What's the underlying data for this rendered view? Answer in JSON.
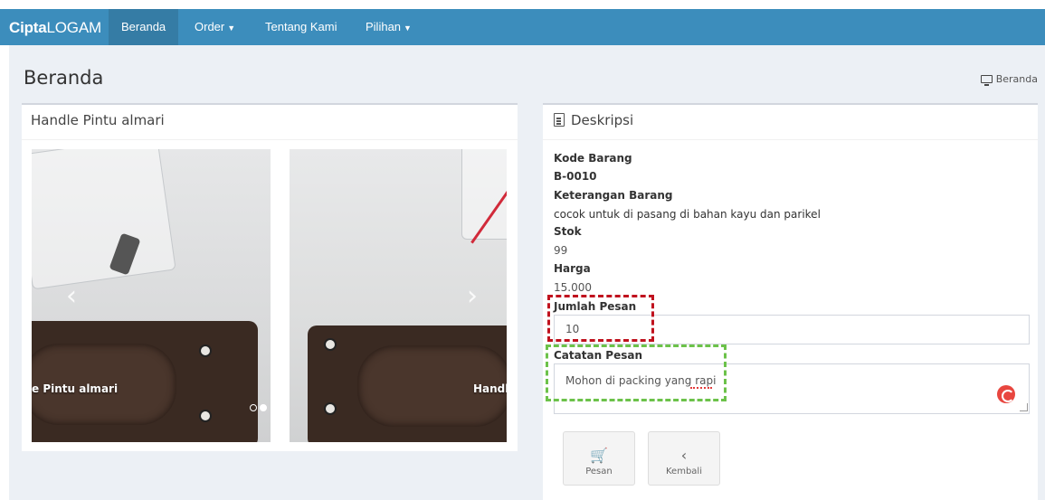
{
  "navbar": {
    "brand_bold": "Cipta",
    "brand_light": "LOGAM",
    "items": [
      {
        "label": "Beranda",
        "active": true
      },
      {
        "label": "Order",
        "dropdown": true
      },
      {
        "label": "Tentang Kami"
      },
      {
        "label": "Pilihan",
        "dropdown": true
      }
    ],
    "color": "#3c8dbc"
  },
  "header": {
    "title": "Beranda",
    "breadcrumb": "Beranda"
  },
  "product_panel": {
    "title": "Handle Pintu almari",
    "slide_caption_left": "e Pintu almari",
    "slide_caption_right": "Handl"
  },
  "description_panel": {
    "title": "Deskripsi",
    "kode_label": "Kode Barang",
    "kode_value": "B-0010",
    "keterangan_label": "Keterangan Barang",
    "keterangan_value": "cocok untuk di pasang di bahan kayu dan parikel",
    "stok_label": "Stok",
    "stok_value": "99",
    "harga_label": "Harga",
    "harga_value": "15.000",
    "jumlah_label": "Jumlah Pesan",
    "jumlah_value": "10",
    "catatan_label": "Catatan Pesan",
    "catatan_value": "Mohon di packing yang rapi"
  },
  "actions": {
    "pesan_label": "Pesan",
    "kembali_label": "Kembali"
  },
  "icons": [
    "cart-icon",
    "chevron-left-icon",
    "monitor-icon",
    "document-icon",
    "grammarly-icon"
  ]
}
